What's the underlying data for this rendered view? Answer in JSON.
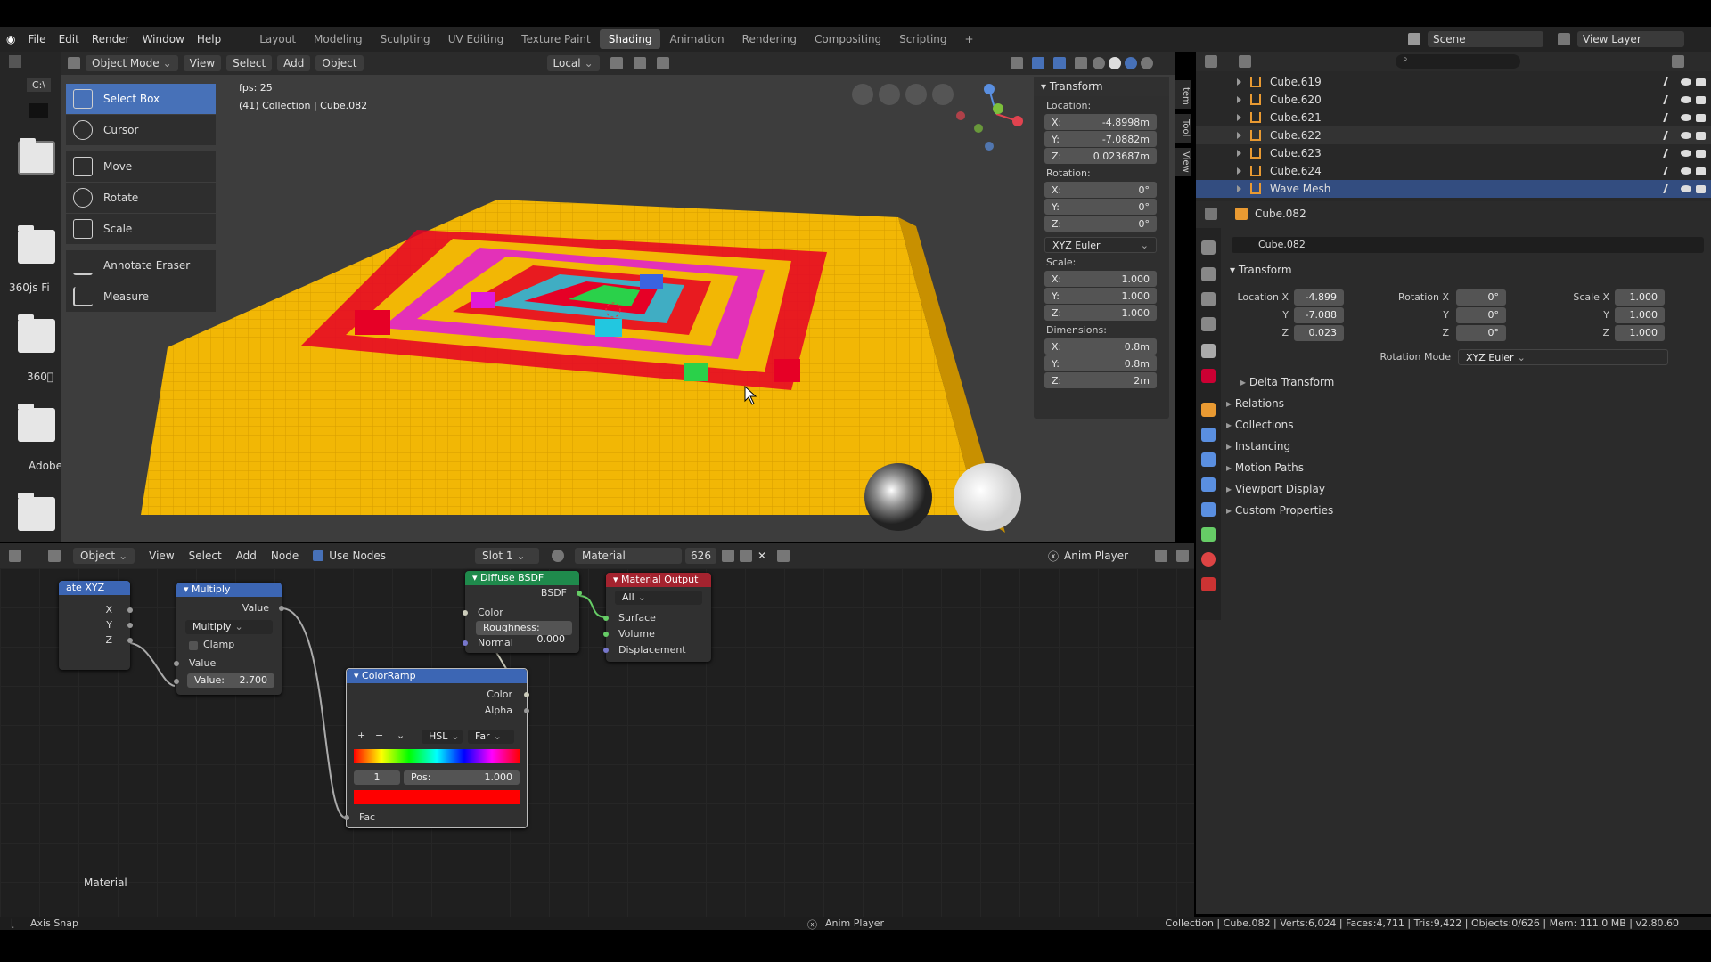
{
  "menu": [
    "File",
    "Edit",
    "Render",
    "Window",
    "Help"
  ],
  "workspaces": [
    "Layout",
    "Modeling",
    "Sculpting",
    "UV Editing",
    "Texture Paint",
    "Shading",
    "Animation",
    "Rendering",
    "Compositing",
    "Scripting",
    "+"
  ],
  "active_workspace": "Shading",
  "scene": {
    "name": "Scene",
    "view_layer": "View Layer"
  },
  "viewport": {
    "mode": "Object Mode",
    "menus": [
      "View",
      "Select",
      "Add",
      "Object"
    ],
    "orientation": "Local",
    "fps": "fps: 25",
    "info": "(41) Collection | Cube.082"
  },
  "tools": [
    "Select Box",
    "Cursor",
    "Move",
    "Rotate",
    "Scale",
    "Annotate Eraser",
    "Measure"
  ],
  "left_strip": {
    "path": "C:\\",
    "labels": [
      "360js Fi",
      "360\u0000",
      "Adobe"
    ]
  },
  "transform_panel": {
    "title": "Transform",
    "location_label": "Location:",
    "location": [
      {
        "axis": "X:",
        "value": "-4.8998m"
      },
      {
        "axis": "Y:",
        "value": "-7.0882m"
      },
      {
        "axis": "Z:",
        "value": "0.023687m"
      }
    ],
    "rotation_label": "Rotation:",
    "rotation": [
      {
        "axis": "X:",
        "value": "0°"
      },
      {
        "axis": "Y:",
        "value": "0°"
      },
      {
        "axis": "Z:",
        "value": "0°"
      }
    ],
    "rotation_mode": "XYZ Euler",
    "scale_label": "Scale:",
    "scale": [
      {
        "axis": "X:",
        "value": "1.000"
      },
      {
        "axis": "Y:",
        "value": "1.000"
      },
      {
        "axis": "Z:",
        "value": "1.000"
      }
    ],
    "dimensions_label": "Dimensions:",
    "dimensions": [
      {
        "axis": "X:",
        "value": "0.8m"
      },
      {
        "axis": "Y:",
        "value": "0.8m"
      },
      {
        "axis": "Z:",
        "value": "2m"
      }
    ],
    "tabs": [
      "Item",
      "Tool",
      "View"
    ]
  },
  "outliner": {
    "items": [
      "Cube.619",
      "Cube.620",
      "Cube.621",
      "Cube.622",
      "Cube.623",
      "Cube.624",
      "Wave Mesh"
    ],
    "selected": "Wave Mesh"
  },
  "properties": {
    "object_name": "Cube.082",
    "data_name": "Cube.082",
    "transform_title": "Transform",
    "location_label": "Location X",
    "location": [
      "-4.899",
      "-7.088",
      "0.023"
    ],
    "rotation_label": "Rotation X",
    "rotation": [
      "0°",
      "0°",
      "0°"
    ],
    "scale_label": "Scale X",
    "scale": [
      "1.000",
      "1.000",
      "1.000"
    ],
    "y_label": "Y",
    "z_label": "Z",
    "rotation_mode_label": "Rotation Mode",
    "rotation_mode": "XYZ Euler",
    "sections": [
      "Delta Transform",
      "Relations",
      "Collections",
      "Instancing",
      "Motion Paths",
      "Viewport Display",
      "Custom Properties"
    ]
  },
  "node_editor": {
    "mode": "Object",
    "menus": [
      "View",
      "Select",
      "Add",
      "Node"
    ],
    "use_nodes": "Use Nodes",
    "slot": "Slot 1",
    "material": "Material",
    "users": "626",
    "anim_player": "Anim Player",
    "frame_label": "Material",
    "nodes": {
      "separate": {
        "title": "ate XYZ",
        "outputs": [
          "X",
          "Y",
          "Z"
        ]
      },
      "multiply": {
        "title": "Multiply",
        "output": "Value",
        "op": "Multiply",
        "clamp": "Clamp",
        "input": "Value",
        "value_label": "Value:",
        "value": "2.700"
      },
      "diffuse": {
        "title": "Diffuse BSDF",
        "output": "BSDF",
        "inputs": [
          "Color",
          "Normal"
        ],
        "rough_label": "Roughness:",
        "roughness": "0.000"
      },
      "output": {
        "title": "Material Output",
        "target": "All",
        "inputs": [
          "Surface",
          "Volume",
          "Displacement"
        ]
      },
      "ramp": {
        "title": "ColorRamp",
        "outputs": [
          "Color",
          "Alpha"
        ],
        "color_mode": "HSL",
        "interp": "Far",
        "index": "1",
        "pos_label": "Pos:",
        "pos": "1.000",
        "input": "Fac"
      }
    }
  },
  "status": {
    "left": "Axis Snap",
    "center": "Anim Player",
    "right": "Collection | Cube.082 | Verts:6,024 | Faces:4,711 | Tris:9,422 | Objects:0/626 | Mem: 111.0 MB | v2.80.60"
  },
  "colors": {
    "accent": "#4771b8",
    "selected_row": "#334d80",
    "mesh_orange": "#e99a32",
    "floor_yellow": "#f2b705"
  }
}
